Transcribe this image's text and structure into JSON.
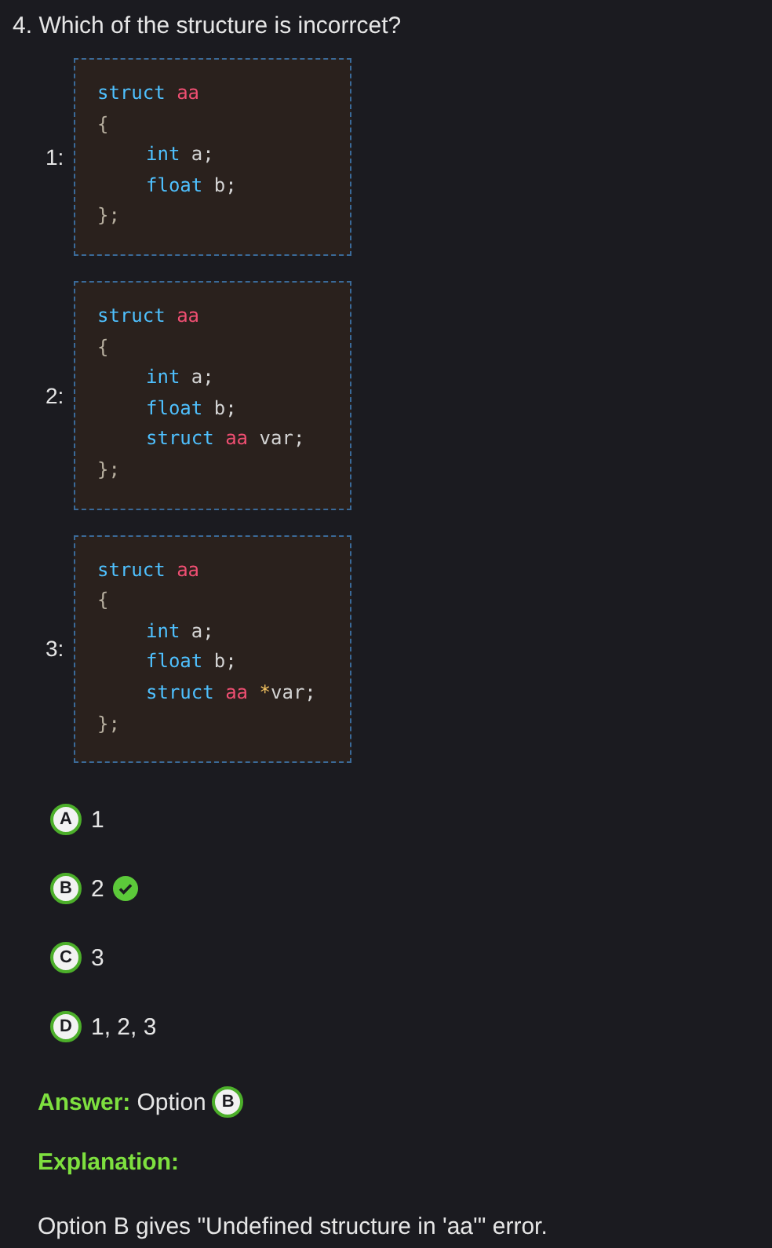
{
  "question": {
    "number": "4.",
    "text": "Which of the structure is incorrcet?"
  },
  "code_blocks": [
    {
      "label": "1:",
      "lines": [
        {
          "indent": false,
          "tokens": [
            {
              "kind": "keyword",
              "text": "struct"
            },
            {
              "kind": "name",
              "text": " aa"
            }
          ]
        },
        {
          "indent": false,
          "tokens": [
            {
              "kind": "brace",
              "text": "{"
            }
          ]
        },
        {
          "indent": true,
          "tokens": [
            {
              "kind": "keyword",
              "text": "int"
            },
            {
              "kind": "plain",
              "text": " a;"
            }
          ]
        },
        {
          "indent": true,
          "tokens": [
            {
              "kind": "keyword",
              "text": "float"
            },
            {
              "kind": "plain",
              "text": " b;"
            }
          ]
        },
        {
          "indent": false,
          "tokens": [
            {
              "kind": "brace",
              "text": "};"
            }
          ]
        }
      ]
    },
    {
      "label": "2:",
      "lines": [
        {
          "indent": false,
          "tokens": [
            {
              "kind": "keyword",
              "text": "struct"
            },
            {
              "kind": "name",
              "text": " aa"
            }
          ]
        },
        {
          "indent": false,
          "tokens": [
            {
              "kind": "brace",
              "text": "{"
            }
          ]
        },
        {
          "indent": true,
          "tokens": [
            {
              "kind": "keyword",
              "text": "int"
            },
            {
              "kind": "plain",
              "text": " a;"
            }
          ]
        },
        {
          "indent": true,
          "tokens": [
            {
              "kind": "keyword",
              "text": "float"
            },
            {
              "kind": "plain",
              "text": " b;"
            }
          ]
        },
        {
          "indent": true,
          "tokens": [
            {
              "kind": "keyword",
              "text": "struct"
            },
            {
              "kind": "name",
              "text": " aa"
            },
            {
              "kind": "plain",
              "text": " var;"
            }
          ]
        },
        {
          "indent": false,
          "tokens": [
            {
              "kind": "brace",
              "text": "};"
            }
          ]
        }
      ]
    },
    {
      "label": "3:",
      "lines": [
        {
          "indent": false,
          "tokens": [
            {
              "kind": "keyword",
              "text": "struct"
            },
            {
              "kind": "name",
              "text": " aa"
            }
          ]
        },
        {
          "indent": false,
          "tokens": [
            {
              "kind": "brace",
              "text": "{"
            }
          ]
        },
        {
          "indent": true,
          "tokens": [
            {
              "kind": "keyword",
              "text": "int"
            },
            {
              "kind": "plain",
              "text": " a;"
            }
          ]
        },
        {
          "indent": true,
          "tokens": [
            {
              "kind": "keyword",
              "text": "float"
            },
            {
              "kind": "plain",
              "text": " b;"
            }
          ]
        },
        {
          "indent": true,
          "tokens": [
            {
              "kind": "keyword",
              "text": "struct"
            },
            {
              "kind": "name",
              "text": " aa"
            },
            {
              "kind": "operator",
              "text": " *"
            },
            {
              "kind": "plain",
              "text": "var;"
            }
          ]
        },
        {
          "indent": false,
          "tokens": [
            {
              "kind": "brace",
              "text": "};"
            }
          ]
        }
      ]
    }
  ],
  "options": [
    {
      "letter": "A",
      "text": "1",
      "correct": false
    },
    {
      "letter": "B",
      "text": "2",
      "correct": true
    },
    {
      "letter": "C",
      "text": "3",
      "correct": false
    },
    {
      "letter": "D",
      "text": "1, 2, 3",
      "correct": false
    }
  ],
  "answer": {
    "label": "Answer:",
    "text": "Option",
    "letter": "B"
  },
  "explanation": {
    "label": "Explanation:",
    "text": "Option B gives \"Undefined structure in 'aa'\" error."
  }
}
